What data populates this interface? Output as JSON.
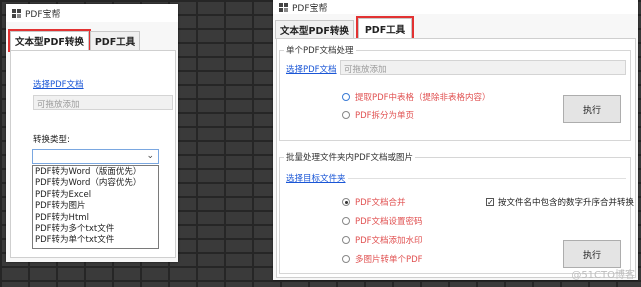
{
  "left_window": {
    "title": "PDF宝帮",
    "tabs": [
      {
        "label": "文本型PDF转换",
        "active": true
      },
      {
        "label": "PDF工具",
        "active": false
      }
    ],
    "select_pdf_link": "选择PDF文档",
    "drag_hint": "可拖放添加",
    "convert_type_label": "转换类型:",
    "convert_type_value": "",
    "dropdown_options": [
      "PDF转为Word（版面优先）",
      "PDF转为Word（内容优先）",
      "PDF转为Excel",
      "PDF转为图片",
      "PDF转为Html",
      "PDF转为多个txt文件",
      "PDF转为单个txt文件"
    ]
  },
  "right_window": {
    "title": "PDF宝帮",
    "tabs": [
      {
        "label": "文本型PDF转换",
        "active": false
      },
      {
        "label": "PDF工具",
        "active": true
      }
    ],
    "single_group": {
      "title": "单个PDF文档处理",
      "select_link": "选择PDF文档",
      "drag_hint": "可拖放添加",
      "options": [
        "提取PDF中表格（提除非表格内容）",
        "PDF拆分为单页"
      ],
      "execute_label": "执行"
    },
    "batch_group": {
      "title": "批量处理文件夹内PDF文档或图片",
      "select_link": "选择目标文件夹",
      "options": [
        "PDF文档合并",
        "PDF文档设置密码",
        "PDF文档添加水印",
        "多图片转单个PDF"
      ],
      "checkbox_label": "按文件名中包含的数字升序合并转换",
      "checkbox_checked": true,
      "execute_label": "执行"
    }
  },
  "watermark": "@51CTO博客"
}
